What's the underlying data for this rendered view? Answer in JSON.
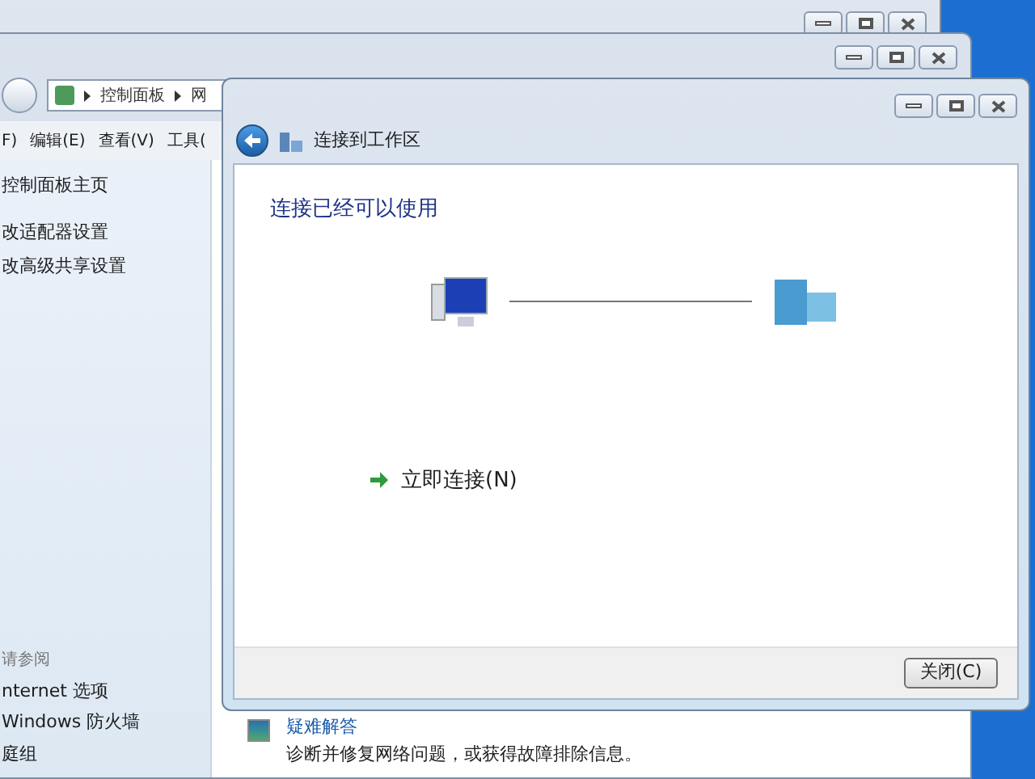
{
  "explorer": {
    "breadcrumb": [
      "控制面板",
      "网"
    ],
    "menu": [
      "F)",
      "编辑(E)",
      "查看(V)",
      "工具("
    ],
    "tasks": [
      "控制面板主页",
      "改适配器设置",
      "改高级共享设置"
    ],
    "see_also": {
      "heading": "请参阅",
      "links": [
        "nternet 选项",
        "Windows 防火墙",
        "庭组"
      ]
    },
    "troubleshoot": {
      "title": "疑难解答",
      "description": "诊断并修复网络问题，或获得故障排除信息。"
    }
  },
  "dialog": {
    "title": "连接到工作区",
    "heading": "连接已经可以使用",
    "action": "立即连接(N)",
    "buttons": [
      "关闭(C)"
    ]
  }
}
